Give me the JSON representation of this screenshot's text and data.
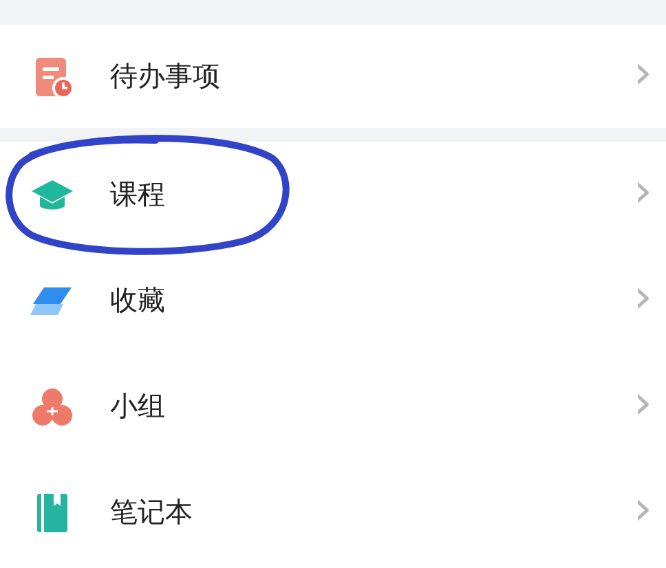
{
  "sections": [
    {
      "items": [
        {
          "kind": "todo",
          "label": "待办事项",
          "chevron": "›",
          "circled": false
        }
      ]
    },
    {
      "items": [
        {
          "kind": "course",
          "label": "课程",
          "chevron": "›",
          "circled": true
        },
        {
          "kind": "favorite",
          "label": "收藏",
          "chevron": "›",
          "circled": false
        },
        {
          "kind": "group",
          "label": "小组",
          "chevron": "›",
          "circled": false
        },
        {
          "kind": "notebook",
          "label": "笔记本",
          "chevron": "›",
          "circled": false
        }
      ]
    }
  ]
}
